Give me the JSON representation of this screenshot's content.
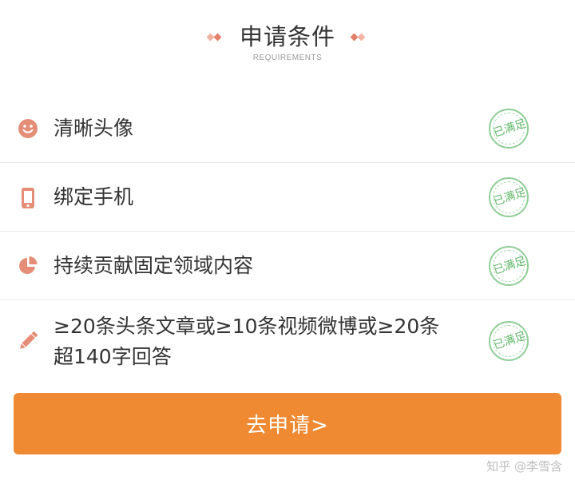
{
  "header": {
    "title": "申请条件",
    "subtitle": "REQUIREMENTS"
  },
  "colors": {
    "accent": "#ef8a33",
    "icon": "#e48e78",
    "stamp_green": "#62b86c",
    "divider": "#e8e8e8"
  },
  "requirements": [
    {
      "icon": "smiley-face-icon",
      "label": "清晰头像",
      "status": "已满足"
    },
    {
      "icon": "phone-icon",
      "label": "绑定手机",
      "status": "已满足"
    },
    {
      "icon": "pie-chart-icon",
      "label": "持续贡献固定领域内容",
      "status": "已满足"
    },
    {
      "icon": "pencil-icon",
      "label_line1": "≥20条头条文章或≥10条视频微博或≥20条",
      "label_line2": "超140字回答",
      "status": "已满足"
    }
  ],
  "apply_button": {
    "label": "去申请>"
  },
  "watermark": "知乎 @李雪含"
}
